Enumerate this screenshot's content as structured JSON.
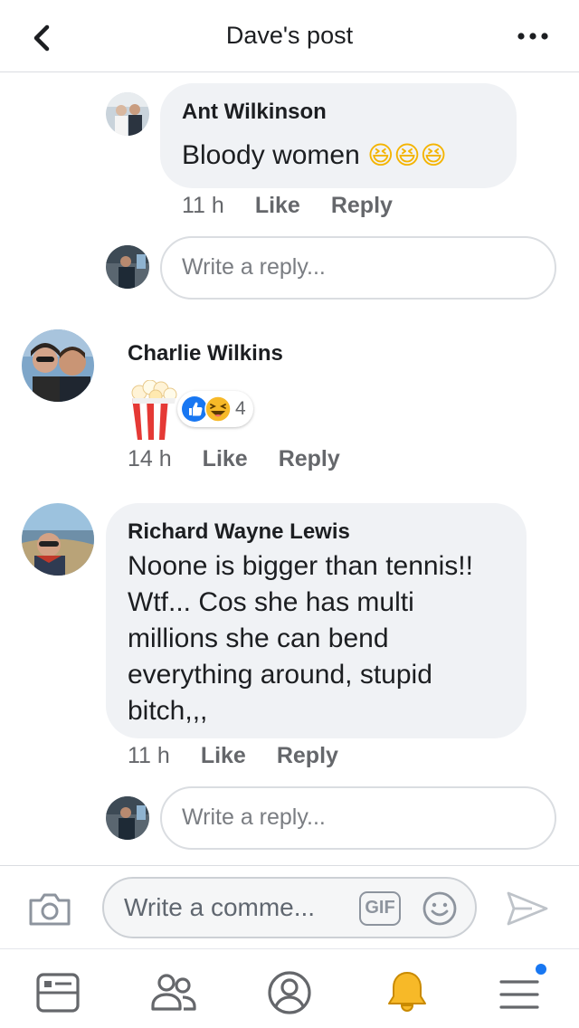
{
  "header": {
    "title": "Dave's post",
    "back_icon": "chevron-left-icon",
    "more_icon": "more-horizontal-icon"
  },
  "comments": [
    {
      "author": "Ant Wilkinson",
      "text": "Bloody women",
      "emoji": "😆😆😆",
      "time": "11 h",
      "like_label": "Like",
      "reply_label": "Reply",
      "reply_placeholder": "Write a reply..."
    },
    {
      "author": "Charlie Wilkins",
      "sticker": "popcorn",
      "reactions": [
        "like",
        "haha"
      ],
      "reaction_count": "4",
      "time": "14 h",
      "like_label": "Like",
      "reply_label": "Reply"
    },
    {
      "author": "Richard Wayne Lewis",
      "text": "Noone is bigger than tennis!! Wtf... Cos she has multi millions she can bend everything around, stupid bitch,,,",
      "lines": [
        "Noone is bigger than tennis!!",
        "Wtf... Cos she has multi",
        "millions she can bend",
        "everything around, stupid",
        "bitch,,,"
      ],
      "time": "11 h",
      "like_label": "Like",
      "reply_label": "Reply",
      "reply_placeholder": "Write a reply..."
    }
  ],
  "composer": {
    "placeholder": "Write a comme...",
    "gif_label": "GIF",
    "camera_icon": "camera-icon",
    "emoji_icon": "smiley-icon",
    "send_icon": "send-icon"
  },
  "nav": {
    "items": [
      "news-feed-icon",
      "friends-icon",
      "profile-icon",
      "notifications-icon",
      "menu-icon"
    ],
    "active_color": "#f7b928",
    "badge_color": "#1877f2"
  }
}
